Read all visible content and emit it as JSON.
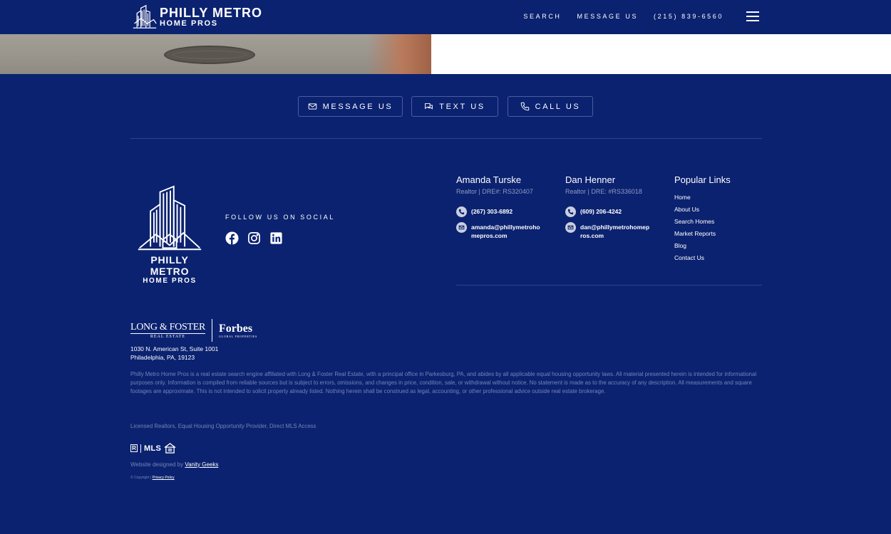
{
  "header": {
    "logo_main": "PHILLY METRO",
    "logo_sub": "HOME PROS",
    "nav": [
      {
        "label": "SEARCH"
      },
      {
        "label": "MESSAGE US"
      },
      {
        "label": "(215) 839-6560"
      }
    ]
  },
  "cta": {
    "message": "MESSAGE US",
    "text": "TEXT US",
    "call": "CALL US"
  },
  "footer": {
    "logo_main": "PHILLY METRO",
    "logo_sub": "HOME PROS",
    "social_title": "FOLLOW US ON SOCIAL",
    "social_icons": [
      "facebook-icon",
      "instagram-icon",
      "linkedin-icon"
    ],
    "agents": [
      {
        "name": "Amanda Turske",
        "title": "Realtor | DRE#: RS320407",
        "phone": "(267) 303-6892",
        "email": "amanda@phillymetrohomepros.com"
      },
      {
        "name": "Dan Henner",
        "title": "Realtor | DRE: #RS336018",
        "phone": "(609) 206-4242",
        "email": "dan@phillymetrohomepros.com"
      }
    ],
    "popular_links": {
      "title": "Popular Links",
      "items": [
        "Home",
        "About Us",
        "Search Homes",
        "Market Reports",
        "Blog",
        "Contact Us"
      ]
    },
    "brokerage": {
      "lf_main": "LONG & FOSTER",
      "lf_sub": "REAL ESTATE",
      "forbes_main": "Forbes",
      "forbes_sub": "GLOBAL PROPERTIES"
    },
    "address_line1": "1030 N. American St, Suite 1001",
    "address_line2": "Philadelphia, PA, 19123",
    "disclaimer": "Philly Metro Home Pros is a real estate search engine affiliated with Long & Foster Real Estate, with a principal office in Parkesburg, PA, and abides by all applicable equal housing opportunity laws. All material presented herein is intended for informational purposes only. Information is compiled from reliable sources but is subject to errors, omissions, and changes in price, condition, sale, or withdrawal without notice. No statement is made as to the accuracy of any description. All measurements and square footages are approximate. This is not intended to solicit property already listed. Nothing herein shall be construed as legal, accounting, or other professional advice outside real estate brokerage.",
    "licensed": "Licensed Realtors, Equal Housing Opportunity Provider, Direct MLS Access",
    "badges": {
      "realtor": "R",
      "mls": "MLS"
    },
    "designed_prefix": "Website designed by",
    "designed_link": "Vanity Geeks",
    "copyright_prefix": "© Copyright |",
    "privacy": "Privacy Policy"
  },
  "colors": {
    "background": "#0b2270",
    "muted_text": "#7384b8",
    "divider": "#2e4488"
  }
}
